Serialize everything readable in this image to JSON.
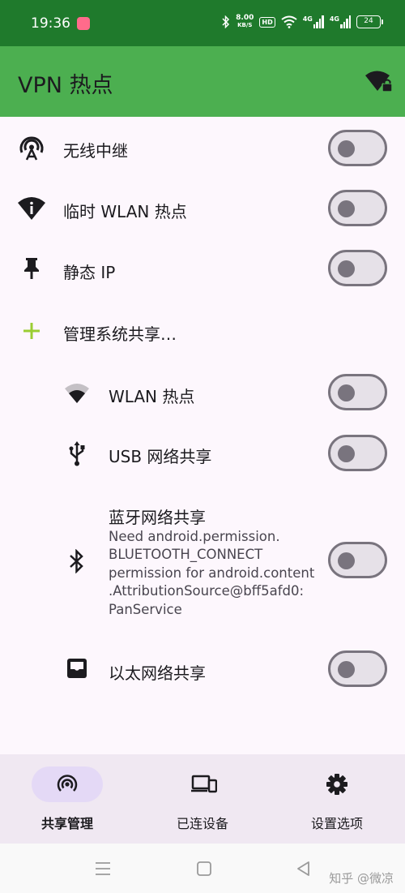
{
  "status_bar": {
    "time": "19:36",
    "speed_value": "8.00",
    "speed_unit": "KB/S",
    "hd": "HD",
    "net1": "4G",
    "net2": "4G",
    "battery": "24"
  },
  "app_bar": {
    "title": "VPN 热点",
    "action_icon": "wifi-lock-icon"
  },
  "list": {
    "repeater": {
      "label": "无线中继",
      "icon": "wifi-tethering-icon",
      "on": false
    },
    "temp_hotspot": {
      "label": "临时 WLAN 热点",
      "icon": "wifi-info-icon",
      "on": false
    },
    "static_ip": {
      "label": "静态 IP",
      "icon": "pin-icon",
      "on": false
    },
    "manage": {
      "label": "管理系统共享…",
      "icon": "plus-icon"
    },
    "wlan_hotspot": {
      "label": "WLAN 热点",
      "icon": "wifi-icon",
      "on": false
    },
    "usb": {
      "label": "USB 网络共享",
      "icon": "usb-icon",
      "on": false
    },
    "bluetooth": {
      "label": "蓝牙网络共享",
      "icon": "bluetooth-icon",
      "desc_lines": [
        "Need android.permission.",
        "BLUETOOTH_CONNECT",
        "permission for android.content",
        ".AttributionSource@bff5afd0:",
        "PanService"
      ],
      "on": false
    },
    "ethernet": {
      "label": "以太网络共享",
      "icon": "ethernet-icon",
      "on": false
    }
  },
  "bottom_nav": {
    "items": [
      {
        "label": "共享管理",
        "icon": "tethering-icon",
        "active": true
      },
      {
        "label": "已连设备",
        "icon": "devices-icon",
        "active": false
      },
      {
        "label": "设置选项",
        "icon": "gear-icon",
        "active": false
      }
    ]
  },
  "system_nav": {
    "watermark": "知乎 @微凉"
  },
  "colors": {
    "status_bar": "#1f7a2c",
    "app_bar": "#4caf50",
    "accent_plus": "#9acd32",
    "nav_active": "#e4d9f6"
  }
}
